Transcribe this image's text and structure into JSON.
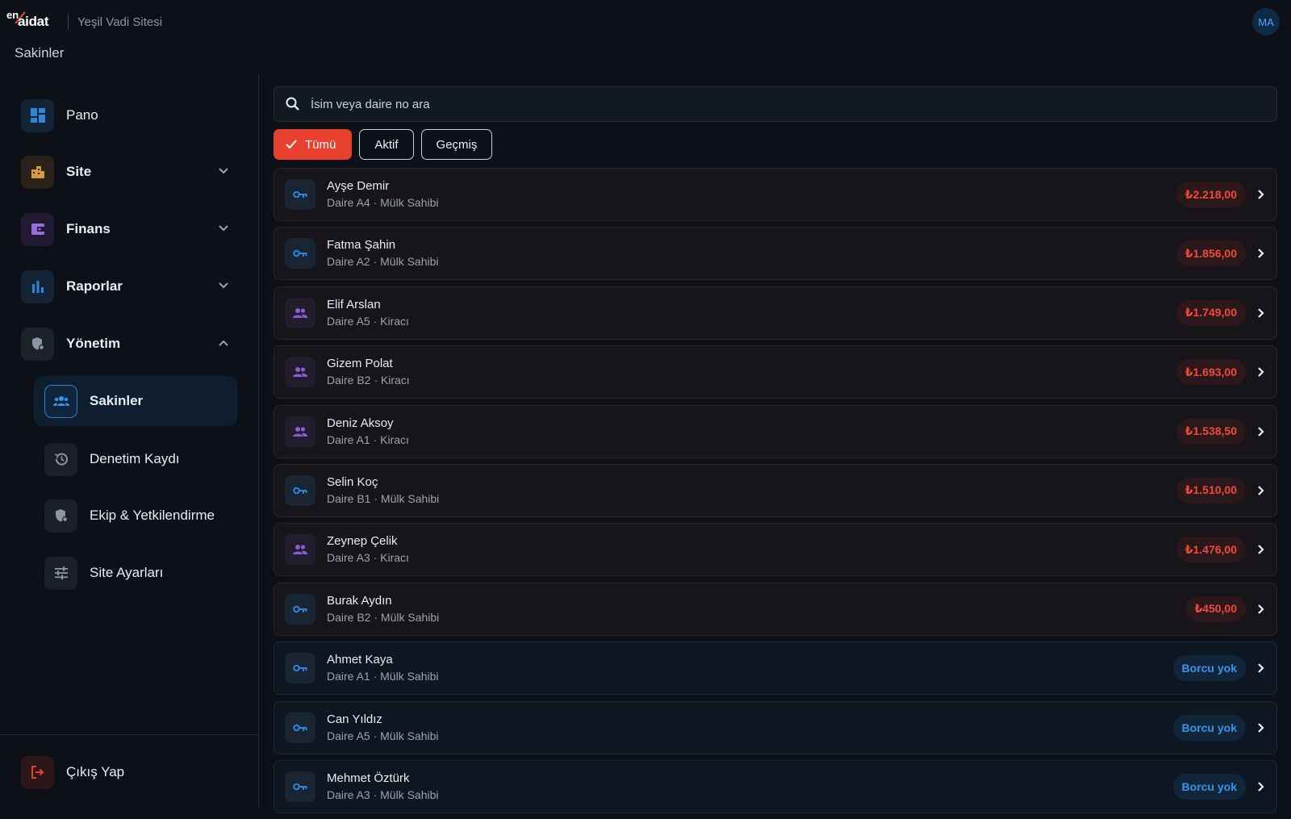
{
  "app": {
    "logo_en": "en",
    "logo_aidat": "aidat",
    "site_name": "Yeşil Vadi Sitesi",
    "avatar_initials": "MA",
    "page_title": "Sakinler"
  },
  "sidebar": {
    "items": [
      {
        "label": "Pano",
        "icon": "dashboard-icon"
      },
      {
        "label": "Site",
        "icon": "apartment-icon"
      },
      {
        "label": "Finans",
        "icon": "wallet-icon"
      },
      {
        "label": "Raporlar",
        "icon": "bar-chart-icon"
      },
      {
        "label": "Yönetim",
        "icon": "admin-shield-icon"
      }
    ],
    "sub_items": [
      {
        "label": "Sakinler",
        "icon": "group-icon",
        "active": true
      },
      {
        "label": "Denetim Kaydı",
        "icon": "history-icon"
      },
      {
        "label": "Ekip & Yetkilendirme",
        "icon": "admin-shield-icon"
      },
      {
        "label": "Site Ayarları",
        "icon": "tune-icon"
      }
    ],
    "logout_label": "Çıkış Yap"
  },
  "search": {
    "placeholder": "İsim veya daire no ara"
  },
  "filters": {
    "all": "Tümü",
    "active": "Aktif",
    "past": "Geçmiş"
  },
  "colors": {
    "accent": "#e8402e",
    "debt": "#ef4a3a",
    "ok": "#3b92e8",
    "owner_icon": "#2f86d6",
    "tenant_icon": "#8a5cd6"
  },
  "residents": [
    {
      "name": "Ayşe Demir",
      "sub": "Daire A4 · Mülk Sahibi",
      "type": "owner",
      "balance": "₺2.218,00",
      "status": "debt"
    },
    {
      "name": "Fatma Şahin",
      "sub": "Daire A2 · Mülk Sahibi",
      "type": "owner",
      "balance": "₺1.856,00",
      "status": "debt"
    },
    {
      "name": "Elif Arslan",
      "sub": "Daire A5 · Kiracı",
      "type": "tenant",
      "balance": "₺1.749,00",
      "status": "debt"
    },
    {
      "name": "Gizem Polat",
      "sub": "Daire B2 · Kiracı",
      "type": "tenant",
      "balance": "₺1.693,00",
      "status": "debt"
    },
    {
      "name": "Deniz Aksoy",
      "sub": "Daire A1 · Kiracı",
      "type": "tenant",
      "balance": "₺1.538,50",
      "status": "debt"
    },
    {
      "name": "Selin Koç",
      "sub": "Daire B1 · Mülk Sahibi",
      "type": "owner",
      "balance": "₺1.510,00",
      "status": "debt"
    },
    {
      "name": "Zeynep Çelik",
      "sub": "Daire A3 · Kiracı",
      "type": "tenant",
      "balance": "₺1.476,00",
      "status": "debt"
    },
    {
      "name": "Burak Aydın",
      "sub": "Daire B2 · Mülk Sahibi",
      "type": "owner",
      "balance": "₺450,00",
      "status": "debt"
    },
    {
      "name": "Ahmet Kaya",
      "sub": "Daire A1 · Mülk Sahibi",
      "type": "owner",
      "balance": "Borcu yok",
      "status": "ok"
    },
    {
      "name": "Can Yıldız",
      "sub": "Daire A5 · Mülk Sahibi",
      "type": "owner",
      "balance": "Borcu yok",
      "status": "ok"
    },
    {
      "name": "Mehmet Öztürk",
      "sub": "Daire A3 · Mülk Sahibi",
      "type": "owner",
      "balance": "Borcu yok",
      "status": "ok"
    }
  ]
}
